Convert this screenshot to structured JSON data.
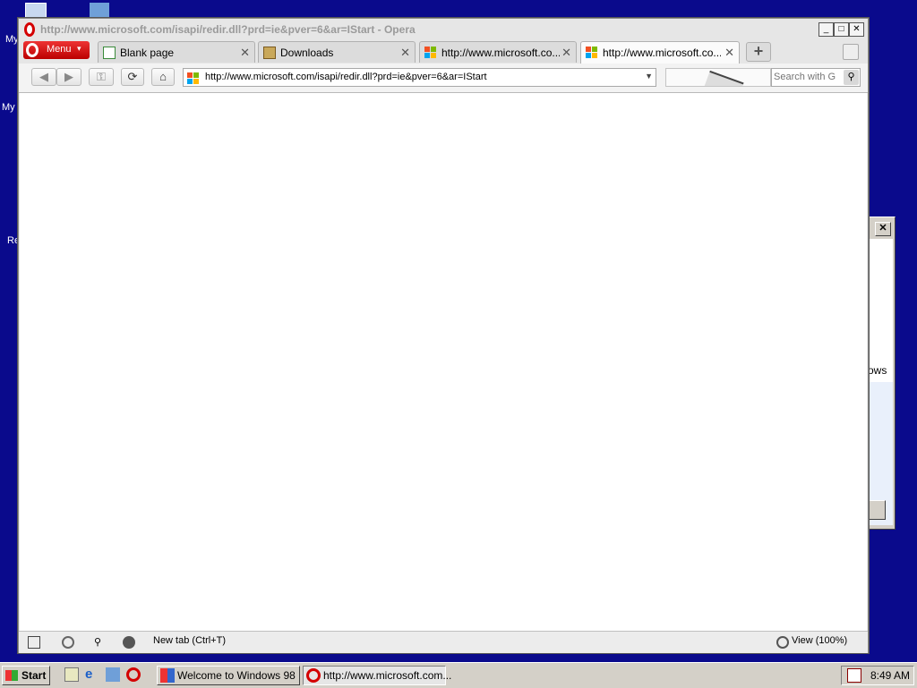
{
  "desktop": {
    "labels": [
      "My",
      "My",
      "Re"
    ]
  },
  "background_dialog": {
    "close_glyph": "✕",
    "partial_text": "ows"
  },
  "window": {
    "title": "http://www.microsoft.com/isapi/redir.dll?prd=ie&pver=6&ar=IStart - Opera",
    "controls": {
      "minimize": "_",
      "maximize": "□",
      "close": "✕"
    }
  },
  "menu": {
    "label": "Menu"
  },
  "tabs": [
    {
      "label": "Blank page",
      "icon": "page-icon"
    },
    {
      "label": "Downloads",
      "icon": "download-icon"
    },
    {
      "label": "http://www.microsoft.co...",
      "icon": "microsoft-icon"
    },
    {
      "label": "http://www.microsoft.co...",
      "icon": "microsoft-icon",
      "active": true
    }
  ],
  "tab_close_glyph": "✕",
  "new_tab_glyph": "+",
  "address": {
    "url": "http://www.microsoft.com/isapi/redir.dll?prd=ie&pver=6&ar=IStart"
  },
  "search": {
    "placeholder": "Search with G"
  },
  "statusbar": {
    "new_tab": "New tab (Ctrl+T)",
    "zoom": "View (100%)"
  },
  "taskbar": {
    "start": "Start",
    "tasks": [
      {
        "label": "Welcome to Windows 98"
      },
      {
        "label": "http://www.microsoft.com..."
      }
    ],
    "clock": "8:49 AM"
  },
  "colors": {
    "desktop": "#0a0a8c",
    "opera_red": "#d40000"
  }
}
